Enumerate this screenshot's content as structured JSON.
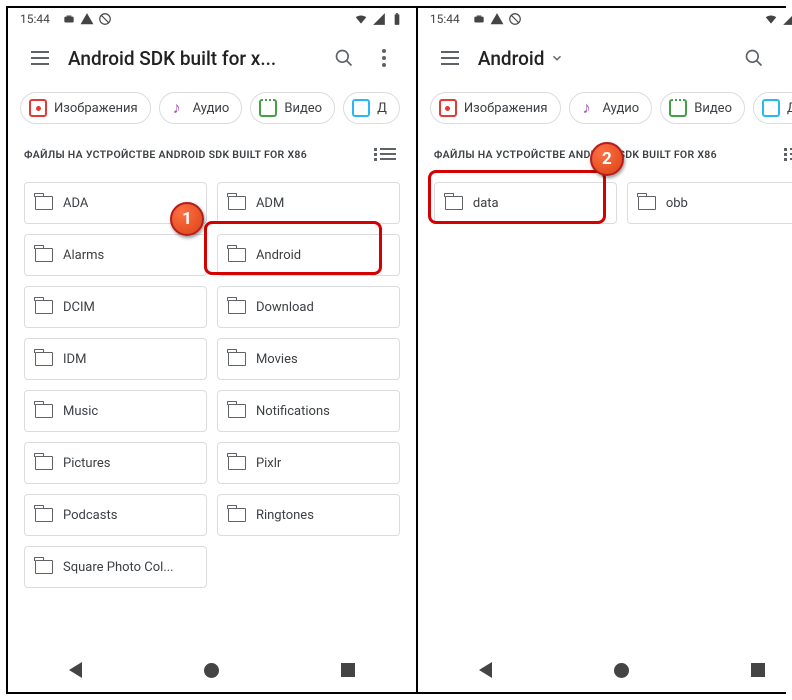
{
  "status": {
    "time": "15:44"
  },
  "left": {
    "appbar": {
      "title": "Android SDK built for x..."
    },
    "chips": {
      "images": "Изображения",
      "audio": "Аудио",
      "video": "Видео",
      "docs": "Д"
    },
    "section_header": "ФАЙЛЫ НА УСТРОЙСТВЕ ANDROID SDK BUILT FOR X86",
    "folders": [
      "ADA",
      "ADM",
      "Alarms",
      "Android",
      "DCIM",
      "Download",
      "IDM",
      "Movies",
      "Music",
      "Notifications",
      "Pictures",
      "Pixlr",
      "Podcasts",
      "Ringtones",
      "Square Photo Col..."
    ],
    "highlight_index": 3,
    "badge": "1"
  },
  "right": {
    "appbar": {
      "title": "Android"
    },
    "chips": {
      "images": "Изображения",
      "audio": "Аудио",
      "video": "Видео",
      "docs": "Д"
    },
    "section_header": "ФАЙЛЫ НА УСТРОЙСТВЕ ANDROID SDK BUILT FOR X86",
    "folders": [
      "data",
      "obb"
    ],
    "highlight_index": 0,
    "badge": "2"
  }
}
